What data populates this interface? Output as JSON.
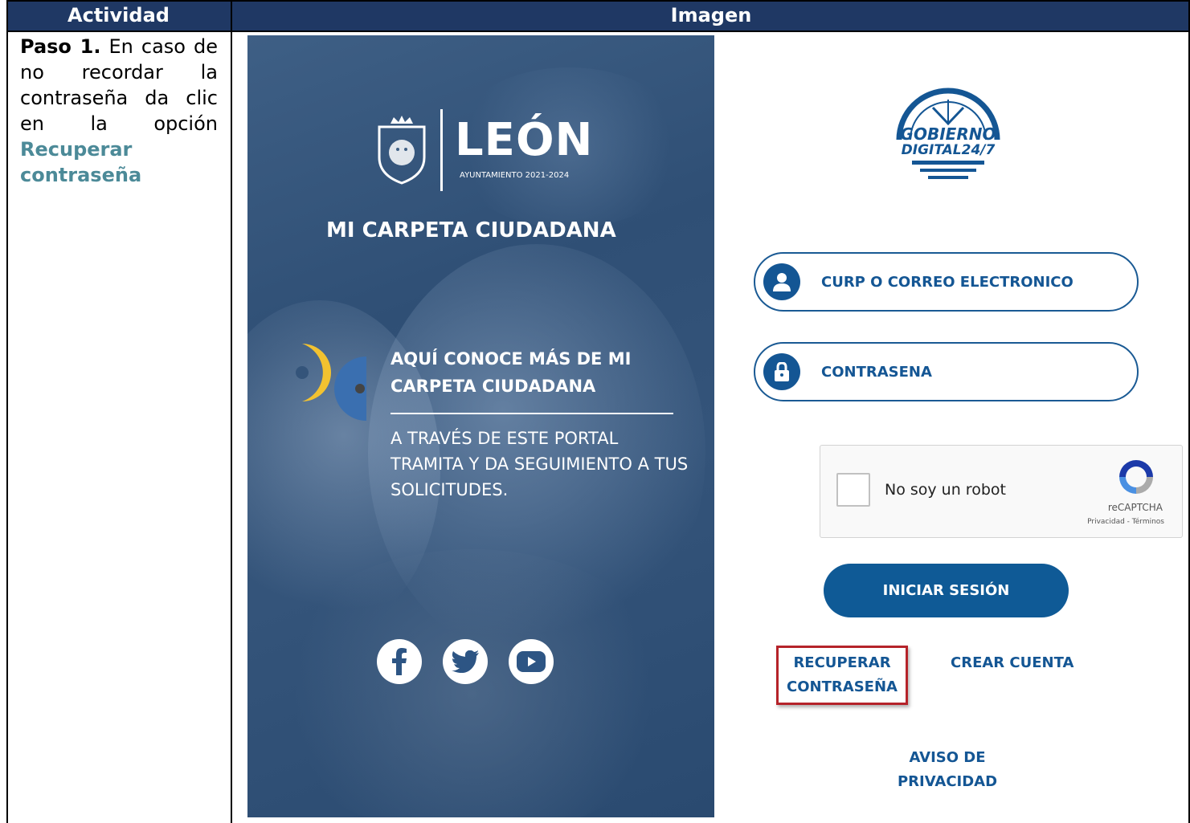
{
  "table": {
    "header_activity": "Actividad",
    "header_image": "Imagen"
  },
  "step": {
    "label": "Paso 1.",
    "text": "En caso de no recordar la contraseña da clic en la opción",
    "link": "Recuperar contraseña"
  },
  "hero": {
    "brand": "LEÓN",
    "brand_subtitle": "AYUNTAMIENTO 2021-2024",
    "title": "MI CARPETA CIUDADANA",
    "promo_heading": "AQUÍ CONOCE MÁS DE MI CARPETA CIUDADANA",
    "promo_text": "A TRAVÉS DE ESTE PORTAL TRAMITA Y DA SEGUIMIENTO A TUS SOLICITUDES.",
    "social": [
      "facebook-icon",
      "twitter-icon",
      "youtube-icon"
    ]
  },
  "login": {
    "logo_text_line1": "GOBIERNO",
    "logo_text_line2": "DIGITAL24/7",
    "user_field": "CURP O CORREO ELECTRONICO",
    "password_field": "CONTRASENA",
    "captcha_label": "No soy un robot",
    "captcha_brand": "reCAPTCHA",
    "captcha_links": "Privacidad - Términos",
    "submit": "INICIAR SESIÓN",
    "recover": "RECUPERAR CONTRASEÑA",
    "create": "CREAR CUENTA",
    "privacy": "AVISO DE PRIVACIDAD"
  },
  "colors": {
    "header_bg": "#1f3864",
    "link_teal": "#4c8a98",
    "brand_blue": "#145694",
    "highlight_red": "#b5232a"
  }
}
